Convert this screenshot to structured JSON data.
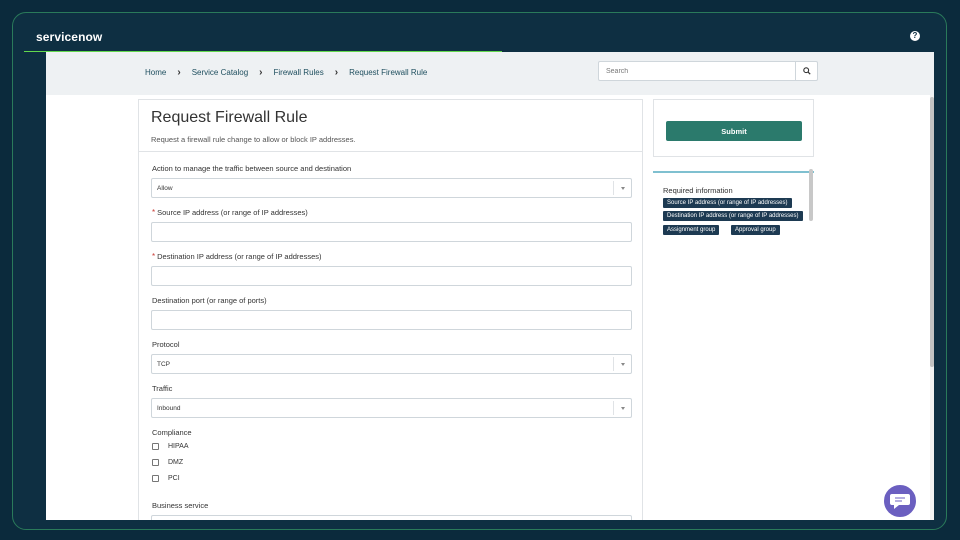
{
  "app": {
    "brand": "servicenow"
  },
  "breadcrumb": [
    "Home",
    "Service Catalog",
    "Firewall Rules",
    "Request Firewall Rule"
  ],
  "search": {
    "placeholder": "Search"
  },
  "form": {
    "title": "Request Firewall Rule",
    "description": "Request a firewall rule change to allow or block IP addresses.",
    "fields": {
      "action": {
        "label": "Action to manage the traffic between source and destination",
        "value": "Allow"
      },
      "source_ip": {
        "label": "Source IP address (or range of IP addresses)",
        "required_mark": "*",
        "value": ""
      },
      "dest_ip": {
        "label": "Destination IP address (or range of IP addresses)",
        "required_mark": "*",
        "value": ""
      },
      "dest_port": {
        "label": "Destination port (or range of ports)",
        "value": ""
      },
      "protocol": {
        "label": "Protocol",
        "value": "TCP"
      },
      "traffic": {
        "label": "Traffic",
        "value": "Inbound"
      },
      "compliance": {
        "label": "Compliance",
        "options": [
          "HIPAA",
          "DMZ",
          "PCI"
        ]
      },
      "business_service": {
        "label": "Business service"
      }
    }
  },
  "sidebar": {
    "submit_label": "Submit",
    "required_title": "Required information",
    "required_tags": [
      "Source IP address (or range of IP addresses)",
      "Destination IP address (or range of IP addresses)",
      "Assignment group",
      "Approval group"
    ]
  },
  "colors": {
    "accent": "#2b7a6c",
    "tag_bg": "#1d3a52",
    "required": "#c83c36",
    "chat": "#6b5fc0"
  },
  "icons": [
    "help-icon",
    "search-icon",
    "chevron-right-icon",
    "chevron-down-icon",
    "chat-icon"
  ]
}
